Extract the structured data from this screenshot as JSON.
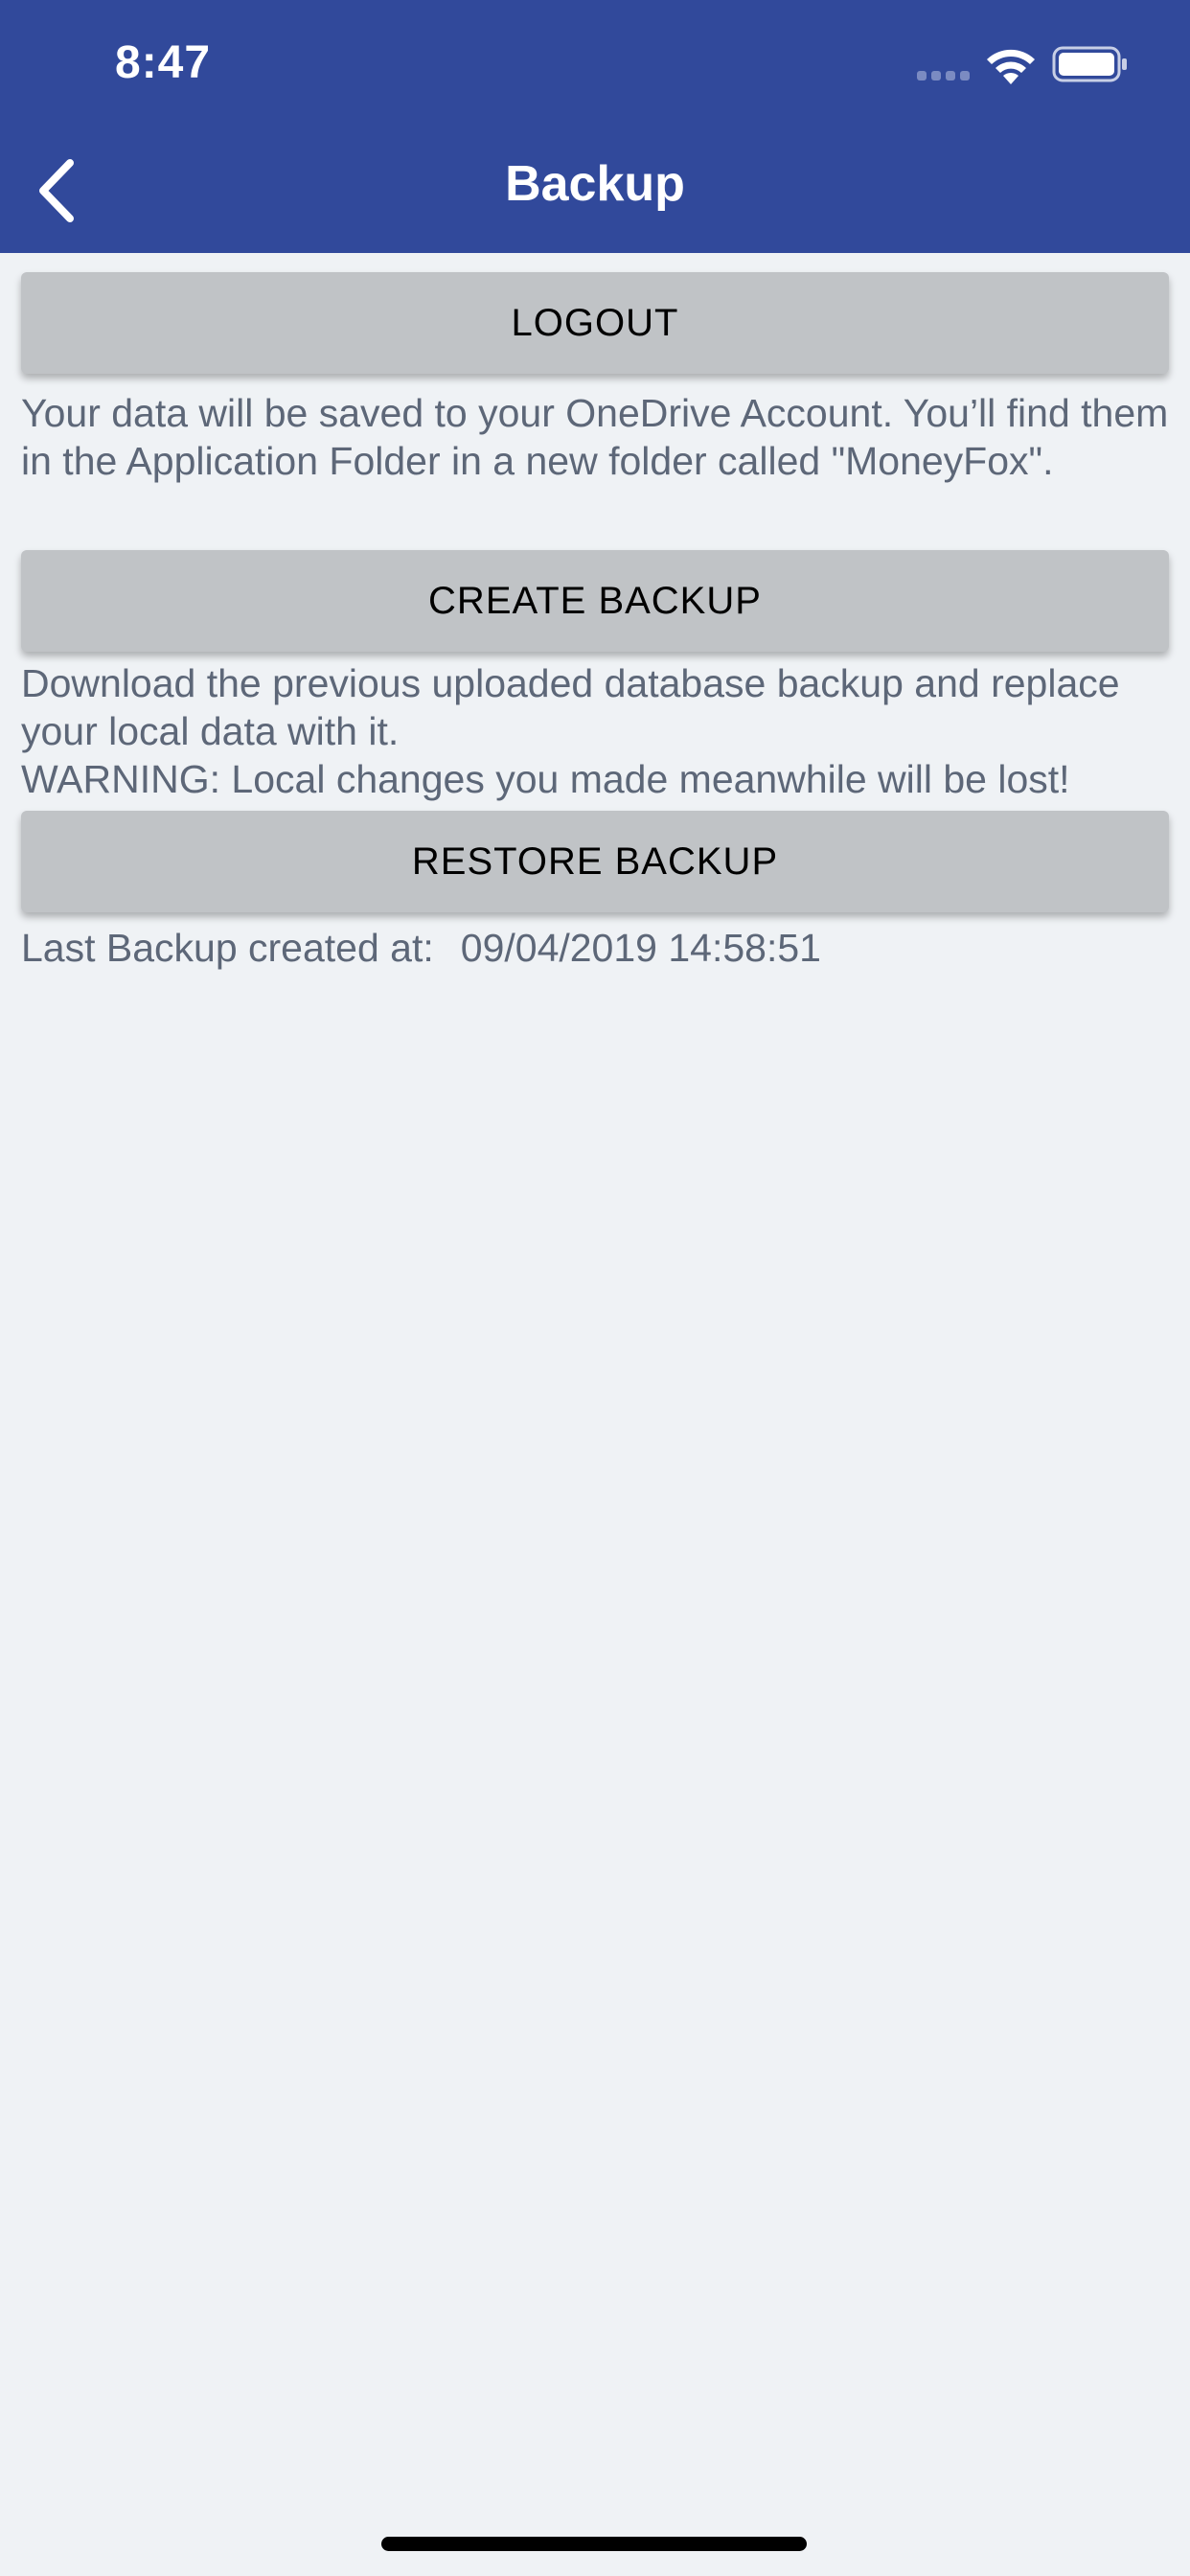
{
  "status_bar": {
    "time": "8:47",
    "icons": [
      "signal-icon",
      "wifi-icon",
      "battery-icon"
    ]
  },
  "nav": {
    "title": "Backup",
    "back_icon": "chevron-left-icon"
  },
  "buttons": {
    "logout": "LOGOUT",
    "create_backup": "CREATE BACKUP",
    "restore_backup": "RESTORE BACKUP"
  },
  "texts": {
    "onedrive_info": "Your data will be saved to your OneDrive Account. You’ll find them in the Application Folder in a new folder called \"MoneyFox\".",
    "restore_info_line1": "Download the previous uploaded database backup and replace your local data with it.",
    "restore_warning": "WARNING: Local changes you made meanwhile will be lost!",
    "last_backup_label": "Last Backup created at:",
    "last_backup_value": "09/04/2019 14:58:51"
  },
  "colors": {
    "header_bg": "#31499b",
    "page_bg": "#eff2f5",
    "button_bg": "#c0c3c6",
    "secondary_text": "#5d6778"
  }
}
